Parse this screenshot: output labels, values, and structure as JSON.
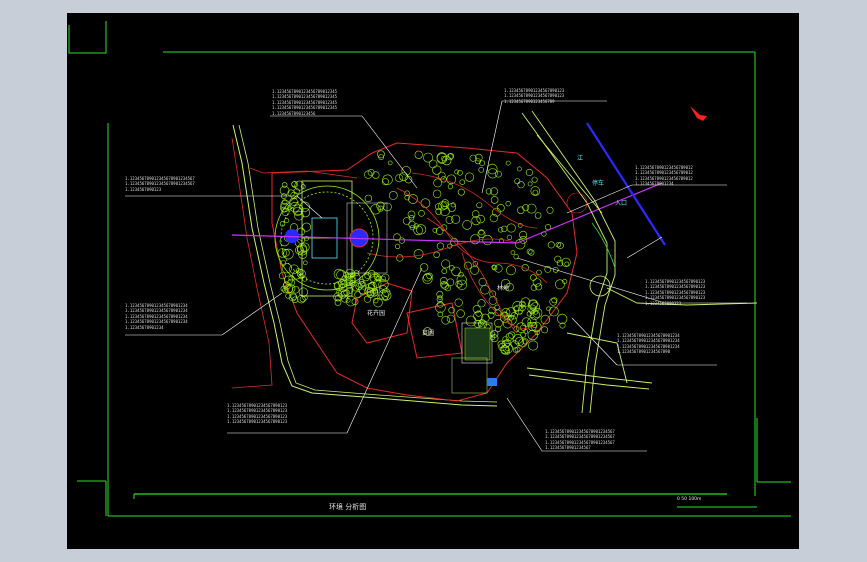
{
  "drawing": {
    "title": "环境 分析图",
    "scale_text": "0  50  100m",
    "north_label": "N",
    "labels": {
      "river": "江",
      "sign_a": "停车",
      "sign_b": "入口",
      "zone_1": "花卉园",
      "zone_2": "苗圃",
      "zone_3": "林地"
    },
    "notes": [
      "1.1234567890123456789012345\n1.1234567890123456789012345\n1.1234567890123456789012345\n1.1234567890123456789012345\n1.1234567890123456",
      "1.12345678901234567890123\n1.12345678901234567890123\n1.1234567890123456789",
      "1.123456789012345678901234567\n1.123456789012345678901234567\n1.1234567890123",
      "1.1234567890123456789012\n1.1234567890123456789012\n1.1234567890123456789012\n1.12345678901234",
      "1.12345678901234567890123\n1.12345678901234567890123\n1.12345678901234567890123\n1.12345678901234567890123\n1.1234567890123",
      "1.123456789012345678901234\n1.123456789012345678901234\n1.123456789012345678901234\n1.123456789012345678901234\n1.12345678901234",
      "1.123456789012345678901234\n1.123456789012345678901234\n1.123456789012345678901234\n1.12345678901234567890",
      "1.12345678901234567890123\n1.12345678901234567890123\n1.12345678901234567890123\n1.12345678901234567890123",
      "1.123456789012345678901234567\n1.123456789012345678901234567\n1.123456789012345678901234567\n1.12345678901234567"
    ]
  },
  "colors": {
    "frame": "#27e227",
    "boundary": "#e32a2a",
    "vegetation": "#9df11b",
    "road": "#c9f26a",
    "river": "#2a2aff",
    "axis": "#cc33ff",
    "leader": "#ffffff"
  }
}
